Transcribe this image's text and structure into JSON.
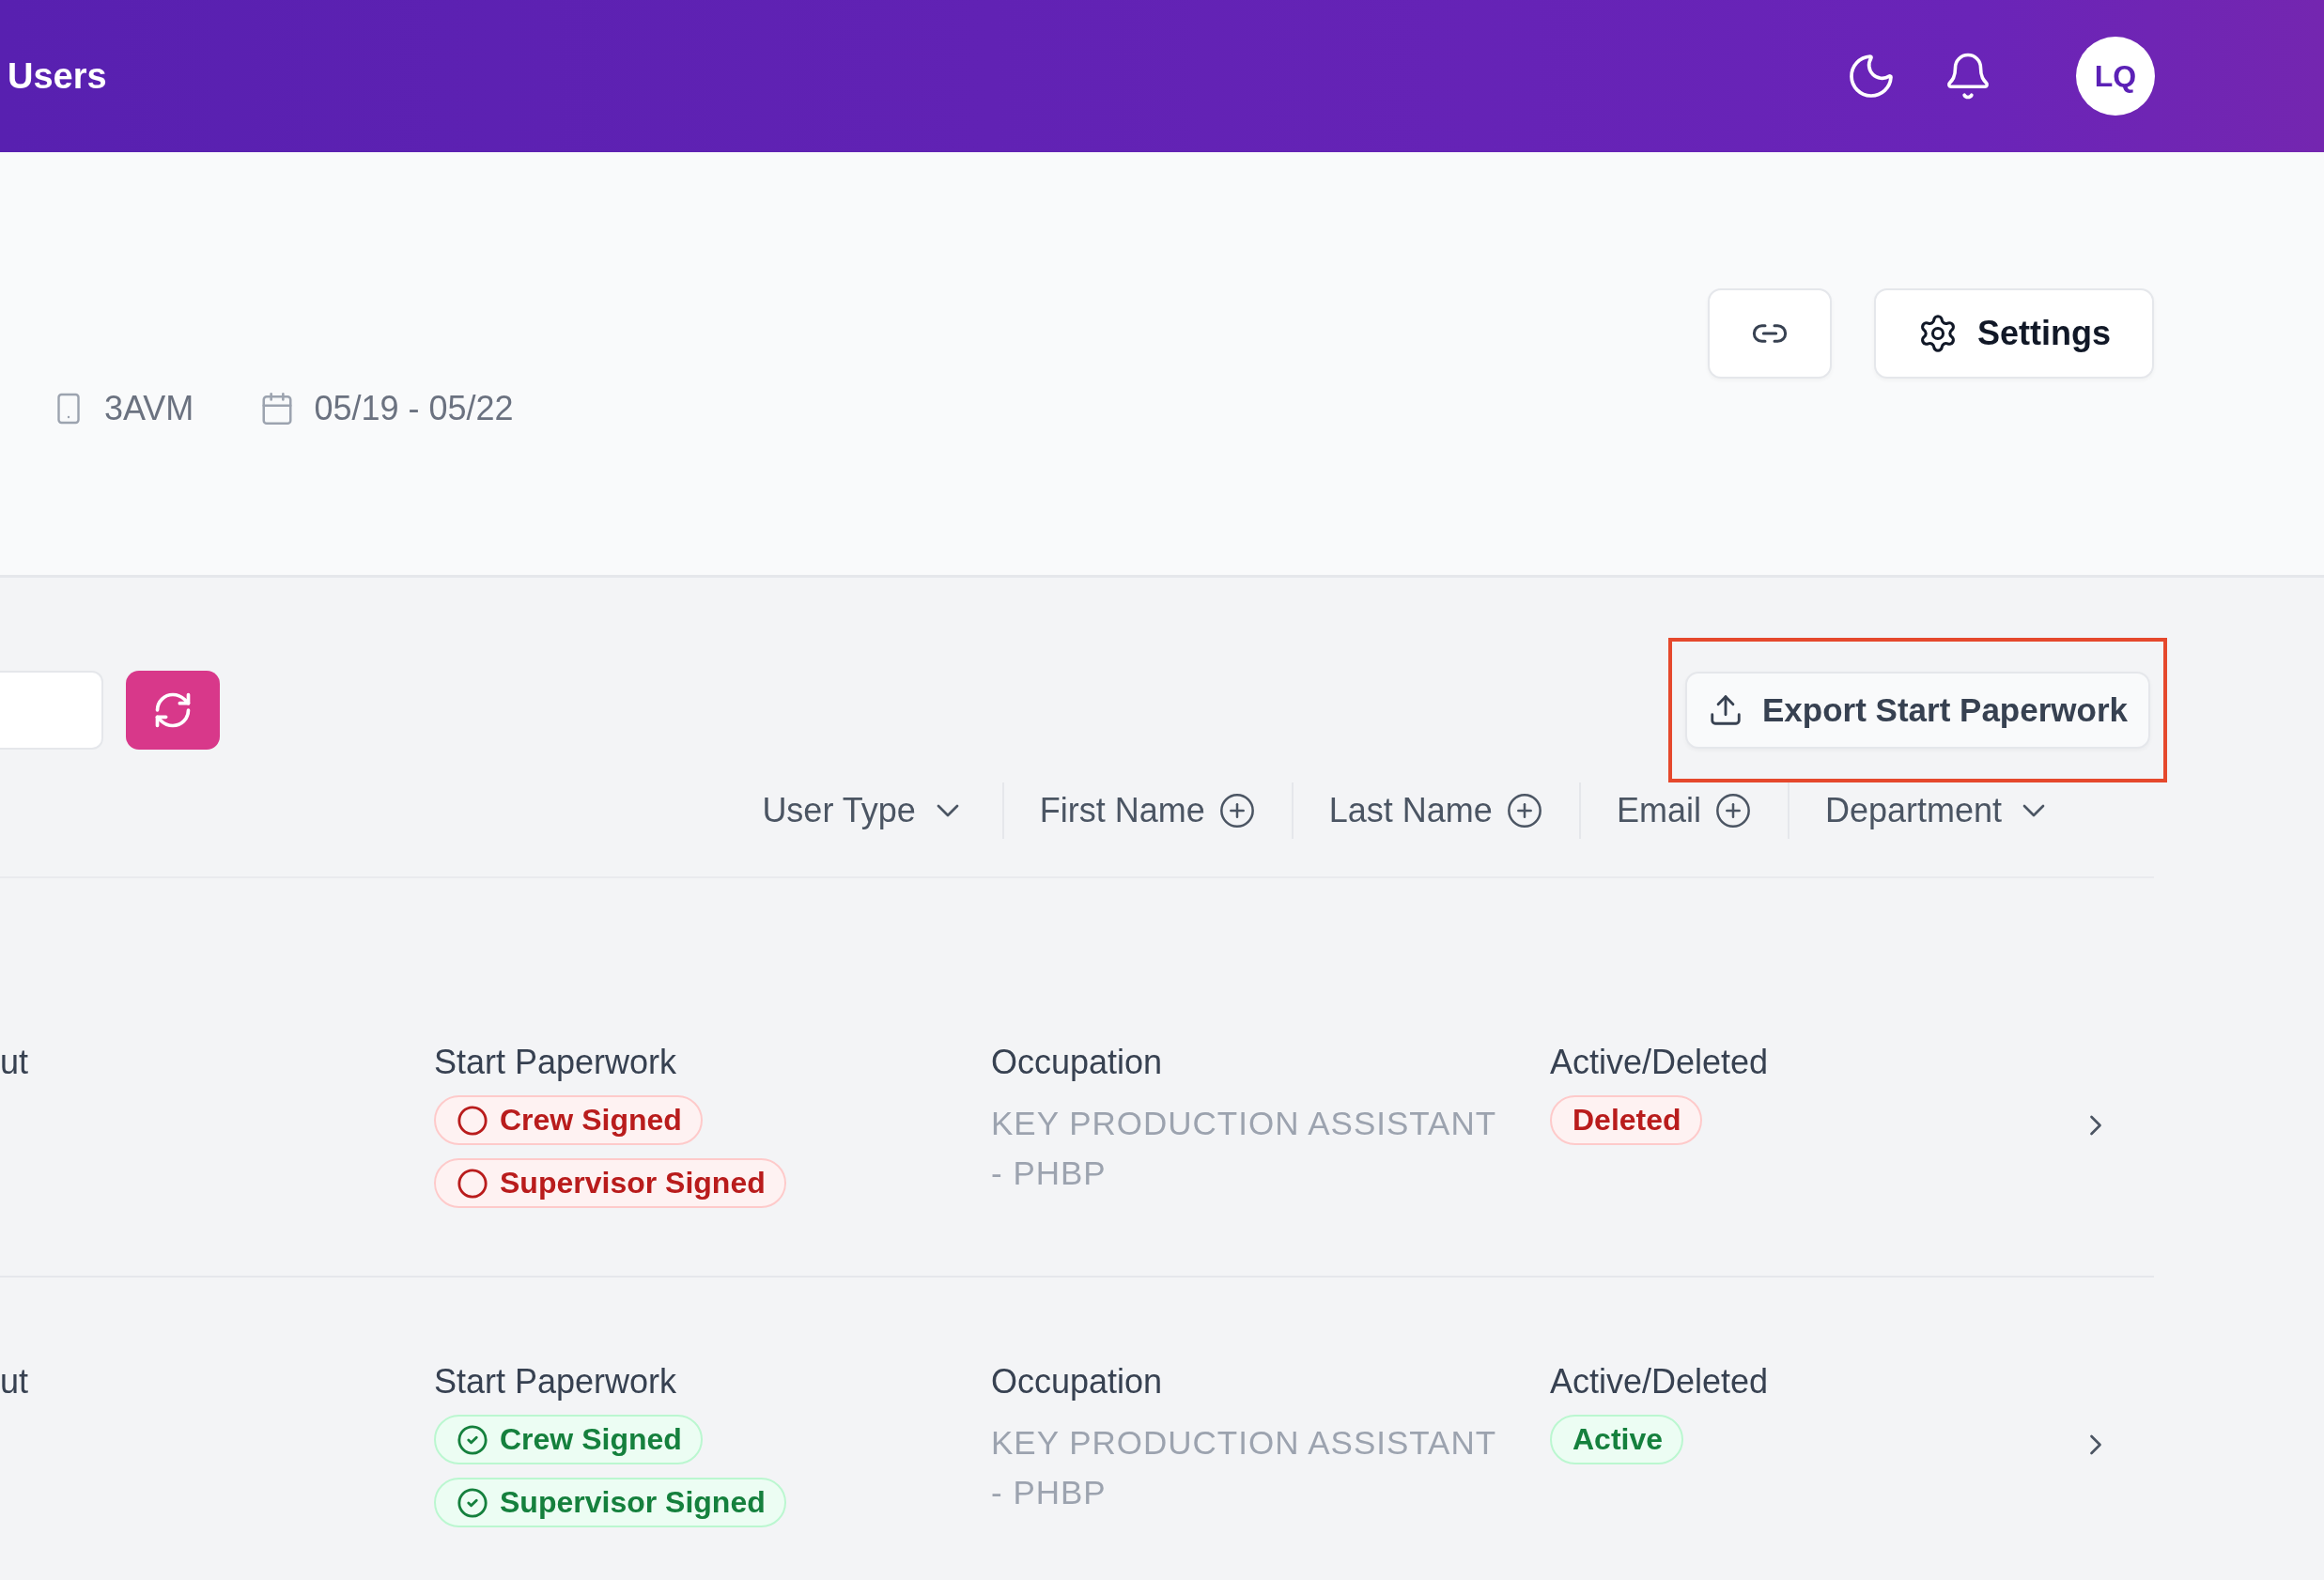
{
  "header": {
    "title": "Users",
    "avatar": "LQ"
  },
  "info": {
    "code": "3AVM",
    "dates": "05/19 - 05/22",
    "settings_label": "Settings"
  },
  "toolbar": {
    "export_label": "Export Start Paperwork",
    "export_highlighted": true
  },
  "filters": [
    {
      "label": "User Type",
      "kind": "dropdown"
    },
    {
      "label": "First Name",
      "kind": "add"
    },
    {
      "label": "Last Name",
      "kind": "add"
    },
    {
      "label": "Email",
      "kind": "add"
    },
    {
      "label": "Department",
      "kind": "dropdown"
    }
  ],
  "rows": [
    {
      "column_1": "ut",
      "paperwork_label": "Start Paperwork",
      "badges": [
        {
          "label": "Crew Signed",
          "signed": false
        },
        {
          "label": "Supervisor Signed",
          "signed": false
        }
      ],
      "occupation_label": "Occupation",
      "occupation": "KEY PRODUCTION ASSISTANT - PHBP",
      "status_label": "Active/Deleted",
      "status": {
        "label": "Deleted",
        "kind": "deleted"
      }
    },
    {
      "column_1": "ut",
      "paperwork_label": "Start Paperwork",
      "badges": [
        {
          "label": "Crew Signed",
          "signed": true
        },
        {
          "label": "Supervisor Signed",
          "signed": true
        }
      ],
      "occupation_label": "Occupation",
      "occupation": "KEY PRODUCTION ASSISTANT - PHBP",
      "status_label": "Active/Deleted",
      "status": {
        "label": "Active",
        "kind": "active"
      }
    }
  ]
}
